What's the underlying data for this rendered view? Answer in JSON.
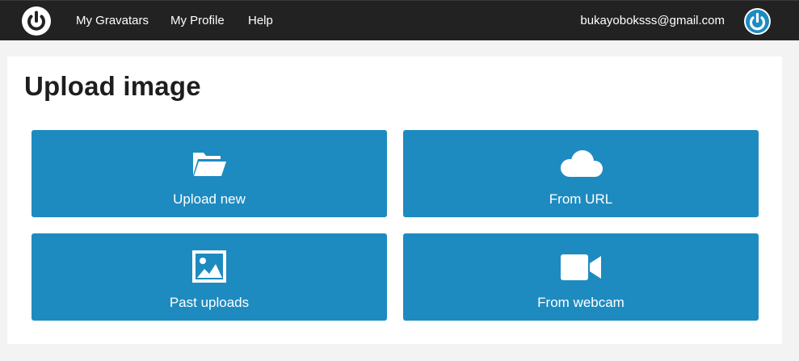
{
  "topbar": {
    "logo_icon": "gravatar-power-logo-icon",
    "nav": [
      {
        "label": "My Gravatars"
      },
      {
        "label": "My Profile"
      },
      {
        "label": "Help"
      }
    ],
    "email": "bukayoboksss@gmail.com",
    "avatar_icon": "gravatar-avatar-icon",
    "background": "#222222"
  },
  "main": {
    "title": "Upload image",
    "tiles": [
      {
        "label": "Upload new",
        "icon": "folder-open-icon"
      },
      {
        "label": "From URL",
        "icon": "cloud-icon"
      },
      {
        "label": "Past uploads",
        "icon": "image-icon"
      },
      {
        "label": "From webcam",
        "icon": "video-camera-icon"
      }
    ],
    "tile_color": "#1e8bc0",
    "accent": "#1e8bc0"
  }
}
